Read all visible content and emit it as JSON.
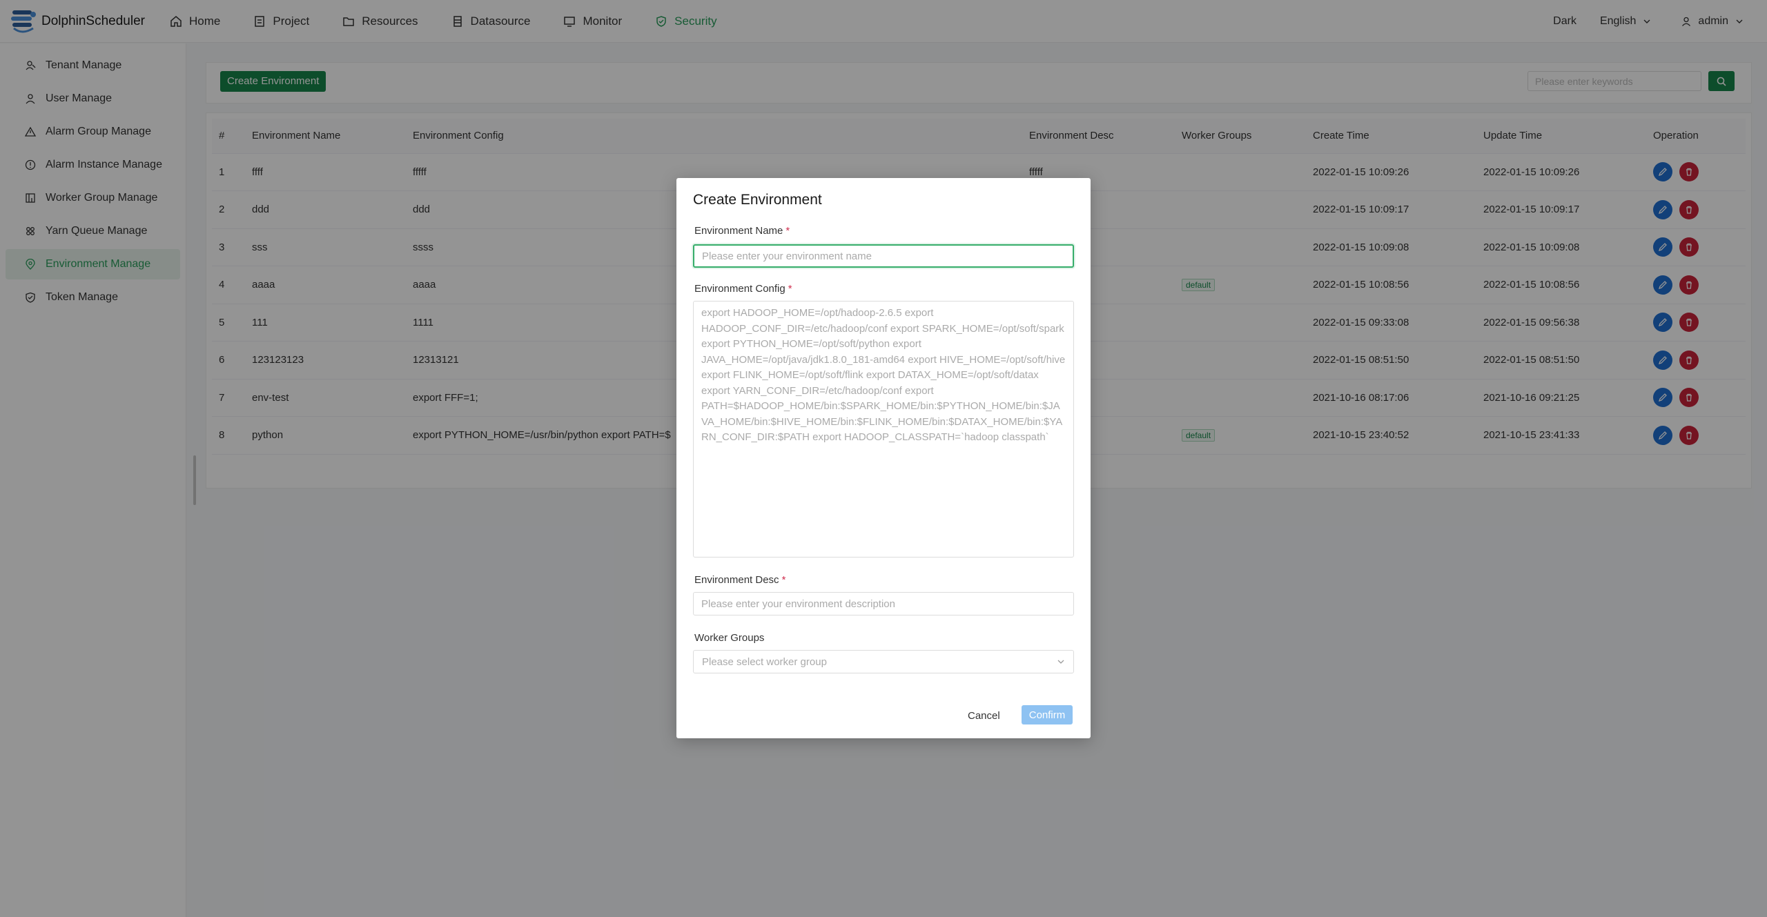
{
  "app": {
    "name": "DolphinScheduler"
  },
  "nav": [
    {
      "label": "Home",
      "icon": "home-icon"
    },
    {
      "label": "Project",
      "icon": "project-icon"
    },
    {
      "label": "Resources",
      "icon": "folder-icon"
    },
    {
      "label": "Datasource",
      "icon": "database-icon"
    },
    {
      "label": "Monitor",
      "icon": "monitor-icon"
    },
    {
      "label": "Security",
      "icon": "shield-icon",
      "active": true
    }
  ],
  "header_right": {
    "theme": "Dark",
    "language": "English",
    "user": "admin"
  },
  "sidebar": [
    {
      "label": "Tenant Manage",
      "icon": "tenant-icon"
    },
    {
      "label": "User Manage",
      "icon": "user-icon"
    },
    {
      "label": "Alarm Group Manage",
      "icon": "warning-icon"
    },
    {
      "label": "Alarm Instance Manage",
      "icon": "info-circle-icon"
    },
    {
      "label": "Worker Group Manage",
      "icon": "grid-icon"
    },
    {
      "label": "Yarn Queue Manage",
      "icon": "cluster-icon"
    },
    {
      "label": "Environment Manage",
      "icon": "location-icon",
      "active": true
    },
    {
      "label": "Token Manage",
      "icon": "shield-check-icon"
    }
  ],
  "toolbar": {
    "create_label": "Create Environment",
    "search_placeholder": "Please enter keywords"
  },
  "table": {
    "columns": [
      "#",
      "Environment Name",
      "Environment Config",
      "Environment Desc",
      "Worker Groups",
      "Create Time",
      "Update Time",
      "Operation"
    ],
    "rows": [
      {
        "idx": "1",
        "name": "ffff",
        "config": "fffff",
        "desc": "fffff",
        "group": "",
        "create": "2022-01-15 10:09:26",
        "update": "2022-01-15 10:09:26"
      },
      {
        "idx": "2",
        "name": "ddd",
        "config": "ddd",
        "desc": "",
        "group": "",
        "create": "2022-01-15 10:09:17",
        "update": "2022-01-15 10:09:17"
      },
      {
        "idx": "3",
        "name": "sss",
        "config": "ssss",
        "desc": "",
        "group": "",
        "create": "2022-01-15 10:09:08",
        "update": "2022-01-15 10:09:08"
      },
      {
        "idx": "4",
        "name": "aaaa",
        "config": "aaaa",
        "desc": "",
        "group": "default",
        "create": "2022-01-15 10:08:56",
        "update": "2022-01-15 10:08:56"
      },
      {
        "idx": "5",
        "name": "111",
        "config": "1111",
        "desc": "",
        "group": "",
        "create": "2022-01-15 09:33:08",
        "update": "2022-01-15 09:56:38"
      },
      {
        "idx": "6",
        "name": "123123123",
        "config": "12313121",
        "desc": "",
        "group": "",
        "create": "2022-01-15 08:51:50",
        "update": "2022-01-15 08:51:50"
      },
      {
        "idx": "7",
        "name": "env-test",
        "config": "export FFF=1;",
        "desc": "",
        "group": "",
        "create": "2021-10-16 08:17:06",
        "update": "2021-10-16 09:21:25"
      },
      {
        "idx": "8",
        "name": "python",
        "config": "export PYTHON_HOME=/usr/bin/python export PATH=$",
        "desc": "",
        "group": "default",
        "create": "2021-10-15 23:40:52",
        "update": "2021-10-15 23:41:33"
      }
    ]
  },
  "modal": {
    "title": "Create Environment",
    "name_label": "Environment Name",
    "name_placeholder": "Please enter your environment name",
    "config_label": "Environment Config",
    "config_placeholder": "export HADOOP_HOME=/opt/hadoop-2.6.5 export HADOOP_CONF_DIR=/etc/hadoop/conf export SPARK_HOME=/opt/soft/spark export PYTHON_HOME=/opt/soft/python export JAVA_HOME=/opt/java/jdk1.8.0_181-amd64 export HIVE_HOME=/opt/soft/hive export FLINK_HOME=/opt/soft/flink export DATAX_HOME=/opt/soft/datax export YARN_CONF_DIR=/etc/hadoop/conf export PATH=$HADOOP_HOME/bin:$SPARK_HOME/bin:$PYTHON_HOME/bin:$JAVA_HOME/bin:$HIVE_HOME/bin:$FLINK_HOME/bin:$DATAX_HOME/bin:$YARN_CONF_DIR:$PATH export HADOOP_CLASSPATH=`hadoop classpath`",
    "desc_label": "Environment Desc",
    "desc_placeholder": "Please enter your environment description",
    "groups_label": "Worker Groups",
    "groups_placeholder": "Please select worker group",
    "required_mark": "*",
    "cancel": "Cancel",
    "confirm": "Confirm"
  },
  "colors": {
    "brand": "#18864b",
    "active_nav": "#2a9d5c",
    "edit": "#1f6fd1",
    "delete": "#c9243a",
    "confirm_disabled": "#8ec2f2"
  }
}
